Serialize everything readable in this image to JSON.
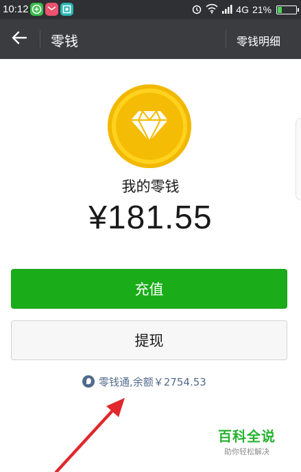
{
  "status_bar": {
    "time": "10:12",
    "network": "4G",
    "battery_percent": "21%",
    "battery_level": 0.21,
    "icons": [
      "app-green-icon",
      "app-mail-icon",
      "app-scan-icon",
      "alarm-icon",
      "wifi-icon",
      "signal-icon",
      "battery-icon"
    ]
  },
  "header": {
    "back_icon": "back-arrow-icon",
    "title": "零钱",
    "detail_link": "零钱明细"
  },
  "wallet": {
    "icon": "diamond-coin-icon",
    "label": "我的零钱",
    "amount": "¥181.55"
  },
  "actions": {
    "recharge_label": "充值",
    "withdraw_label": "提现"
  },
  "lingqiantong": {
    "icon": "lingqiantong-icon",
    "text": "零钱通,余额￥2754.53"
  },
  "watermark": {
    "title": "百科全说",
    "subtitle": "助你轻松解决"
  },
  "colors": {
    "status_bar": "#2f3033",
    "title_bar": "#3b3c40",
    "primary_green": "#1aad19",
    "coin_gold": "#f4bc05",
    "link_blue": "#536b8b",
    "annotation_red": "#e0282d",
    "watermark_green": "#25b22f"
  }
}
